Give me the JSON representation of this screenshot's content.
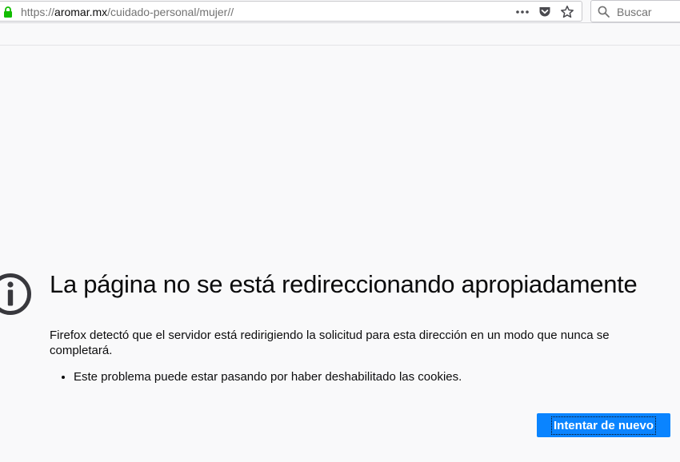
{
  "browser": {
    "url": {
      "scheme": "https://",
      "domain": "aromar.mx",
      "path": "/cuidado-personal/mujer//"
    },
    "search": {
      "placeholder": "Buscar"
    },
    "icons": {
      "lock": "lock-icon",
      "page_actions": "ellipsis-icon",
      "pocket": "pocket-icon",
      "bookmark": "star-icon",
      "search": "search-icon"
    }
  },
  "error_page": {
    "icon": "info-icon",
    "title": "La página no se está redireccionando apropiadamente",
    "description": "Firefox detectó que el servidor está redirigiendo la solicitud para esta dirección en un modo que nunca se completará.",
    "bullets": [
      "Este problema puede estar pasando por haber deshabilitado las cookies."
    ],
    "try_again_label": "Intentar de nuevo"
  },
  "colors": {
    "lock_green": "#12bc00",
    "primary_button": "#0a84ff",
    "page_background": "#f9f9fa",
    "text": "#0c0c0d"
  }
}
